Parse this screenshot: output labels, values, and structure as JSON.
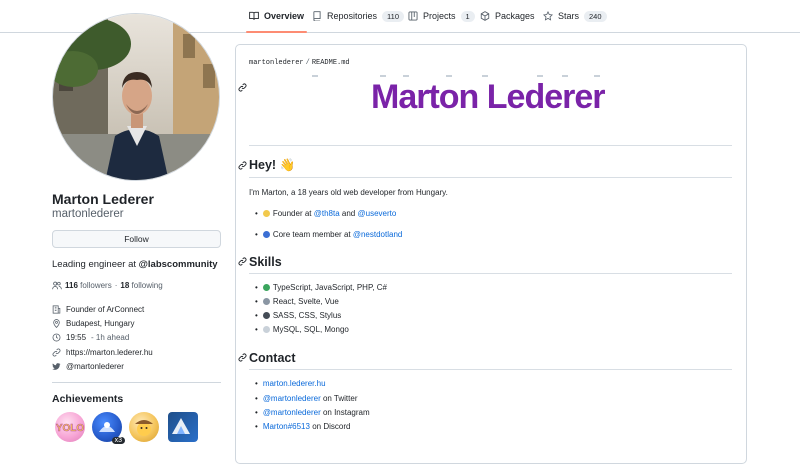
{
  "tabs": [
    {
      "label": "Overview",
      "icon": "book-icon",
      "active": true
    },
    {
      "label": "Repositories",
      "icon": "repo-icon",
      "count": "110"
    },
    {
      "label": "Projects",
      "icon": "project-icon",
      "count": "1"
    },
    {
      "label": "Packages",
      "icon": "package-icon"
    },
    {
      "label": "Stars",
      "icon": "star-icon",
      "count": "240"
    }
  ],
  "profile": {
    "name": "Marton Lederer",
    "login": "martonlederer",
    "follow_label": "Follow",
    "bio_prefix": "Leading engineer at ",
    "bio_org": "@labscommunity",
    "followers_count": "116",
    "followers_label": "followers",
    "dot": "·",
    "following_count": "18",
    "following_label": "following",
    "details": [
      {
        "icon": "organization-icon",
        "text": "Founder of ArConnect"
      },
      {
        "icon": "location-icon",
        "text": "Budapest, Hungary"
      },
      {
        "icon": "clock-icon",
        "text": "19:55",
        "extra": "- 1h ahead"
      },
      {
        "icon": "link-icon",
        "text": "https://marton.lederer.hu"
      },
      {
        "icon": "twitter-icon",
        "text": "@martonlederer"
      }
    ],
    "achievements_title": "Achievements",
    "achievement_multiplier": "x3"
  },
  "readme": {
    "owner": "martonlederer",
    "separator": "/",
    "file": "README.md",
    "hero_title": "Marton Lederer",
    "hey_heading": "Hey! 👋",
    "intro": "I'm Marton, a 18 years old web developer from Hungary.",
    "roles": [
      {
        "emoji_color": "#f2c94c",
        "prefix": "Founder at ",
        "link1": "@th8ta",
        "mid": " and ",
        "link2": "@useverto"
      },
      {
        "emoji_color": "#3b6fd4",
        "prefix": "Core team member at ",
        "link1": "@nestdotland",
        "mid": "",
        "link2": ""
      }
    ],
    "skills_heading": "Skills",
    "skills": [
      {
        "emoji_color": "#3aa55d",
        "text": "TypeScript, JavaScript, PHP, C#"
      },
      {
        "emoji_color": "#8a96a3",
        "text": "React, Svelte, Vue"
      },
      {
        "emoji_color": "#444c56",
        "text": "SASS, CSS, Stylus"
      },
      {
        "emoji_color": "#c9d1d9",
        "text": "MySQL, SQL, Mongo"
      }
    ],
    "contact_heading": "Contact",
    "contacts": [
      {
        "link": "marton.lederer.hu",
        "suffix": ""
      },
      {
        "link": "@martonlederer",
        "suffix": " on Twitter"
      },
      {
        "link": "@martonlederer",
        "suffix": " on Instagram"
      },
      {
        "link": "Marton#6513",
        "suffix": " on Discord"
      }
    ]
  },
  "colors": {
    "accent_tab": "#fd8c73",
    "link": "#0969da",
    "hero": "#7a23a8"
  }
}
